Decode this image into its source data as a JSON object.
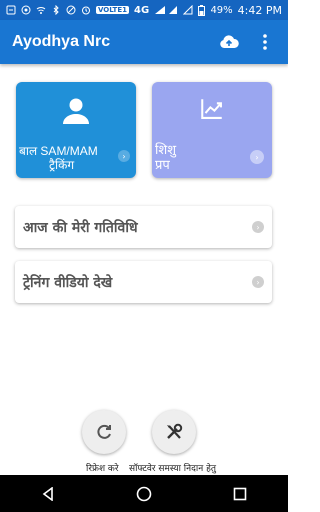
{
  "status_bar": {
    "network_badge": "VOLTE1",
    "network": "4G",
    "network_sup": "4G",
    "battery": "49%",
    "time": "4:42 PM"
  },
  "app_bar": {
    "title": "Ayodhya Nrc",
    "icons": [
      "cloud-upload-icon",
      "more-vert-icon"
    ]
  },
  "tiles": [
    {
      "label_line1": "बाल SAM/MAM",
      "label_line2": "ट्रैकिंग",
      "icon": "person-icon",
      "color": "#2090d8"
    },
    {
      "label_line1": "शिशु",
      "label_line2": "प्रप",
      "icon": "trending-up-icon",
      "color": "#9aa6f0"
    }
  ],
  "cards": [
    {
      "label": "आज की मेरी गतिविधि"
    },
    {
      "label": "ट्रेनिंग वीडियो देखे"
    }
  ],
  "bottom_actions": [
    {
      "label": "रिफ्रेश करे",
      "icon": "refresh-icon"
    },
    {
      "label": "सॉफ्टवेर समस्या निदान हेतु",
      "icon": "tools-icon"
    }
  ],
  "colors": {
    "status_bar": "#1565c0",
    "app_bar": "#1976d2",
    "tile1": "#2090d8",
    "tile2": "#9aa6f0"
  }
}
